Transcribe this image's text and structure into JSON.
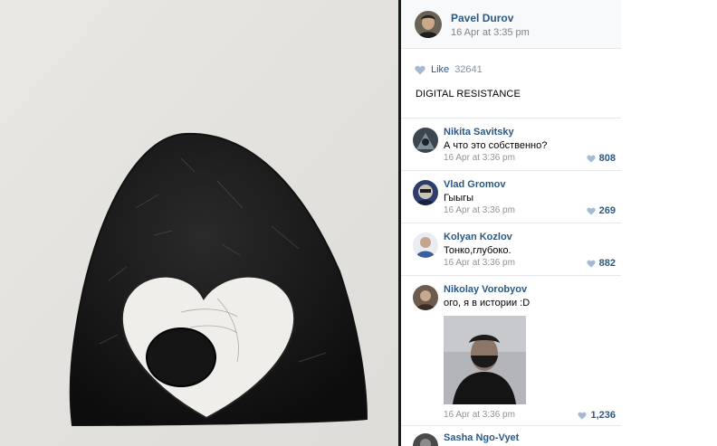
{
  "post": {
    "author": "Pavel Durov",
    "date": "16 Apr at 3:35 pm",
    "like_label": "Like",
    "like_count": "32641",
    "text": "DIGITAL RESISTANCE"
  },
  "comments": [
    {
      "author": "Nikita Savitsky",
      "text": "А что это собственно?",
      "date": "16 Apr at 3:36 pm",
      "likes": "808"
    },
    {
      "author": "Vlad Gromov",
      "text": "Гыыгы",
      "date": "16 Apr at 3:36 pm",
      "likes": "269"
    },
    {
      "author": "Kolyan Kozlov",
      "text": "Тонко,глубоко.",
      "date": "16 Apr at 3:36 pm",
      "likes": "882"
    },
    {
      "author": "Nikolay Vorobyov",
      "text": "ого, я в истории :D",
      "date": "16 Apr at 3:36 pm",
      "likes": "1,236",
      "has_photo": true
    },
    {
      "author": "Sasha Ngo-Vyet"
    }
  ],
  "colors": {
    "link": "#2a5885",
    "muted": "#828282",
    "like_heart": "#a6bad3",
    "divider": "#e7e8ec",
    "photo_background": "#e6e4e0"
  },
  "icons": {
    "like": "heart-icon"
  }
}
